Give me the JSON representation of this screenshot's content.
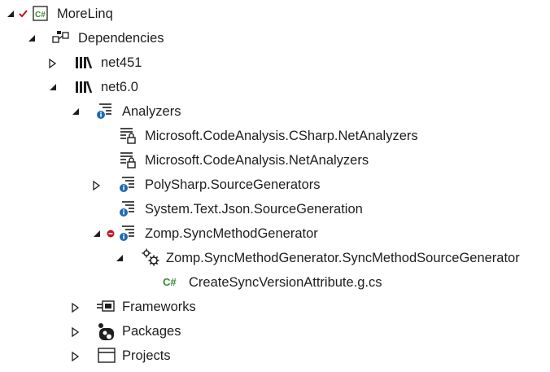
{
  "tree": {
    "root": {
      "label": "MoreLinq",
      "icon": "csharp-project-icon",
      "status": "checked"
    },
    "dependencies": {
      "label": "Dependencies",
      "icon": "dependencies-icon"
    },
    "net451": {
      "label": "net451",
      "icon": "framework-library-icon",
      "expanded": false
    },
    "net60": {
      "label": "net6.0",
      "icon": "framework-library-icon",
      "expanded": true
    },
    "analyzers": {
      "label": "Analyzers",
      "icon": "analyzer-info-icon",
      "expanded": true
    },
    "analyzer_items": [
      {
        "label": "Microsoft.CodeAnalysis.CSharp.NetAnalyzers",
        "icon": "analyzer-locked-icon"
      },
      {
        "label": "Microsoft.CodeAnalysis.NetAnalyzers",
        "icon": "analyzer-locked-icon"
      },
      {
        "label": "PolySharp.SourceGenerators",
        "icon": "analyzer-info-icon",
        "expanded": false
      },
      {
        "label": "System.Text.Json.SourceGeneration",
        "icon": "analyzer-info-icon"
      },
      {
        "label": "Zomp.SyncMethodGenerator",
        "icon": "analyzer-info-icon",
        "expanded": true,
        "status": "removed"
      }
    ],
    "generator": {
      "label": "Zomp.SyncMethodGenerator.SyncMethodSourceGenerator",
      "icon": "gears-icon",
      "expanded": true
    },
    "generated_file": {
      "label": "CreateSyncVersionAttribute.g.cs",
      "icon": "csharp-file-icon"
    },
    "frameworks": {
      "label": "Frameworks",
      "icon": "frameworks-icon",
      "expanded": false
    },
    "packages": {
      "label": "Packages",
      "icon": "nuget-package-icon",
      "expanded": false
    },
    "projects": {
      "label": "Projects",
      "icon": "project-window-icon",
      "expanded": false
    }
  },
  "colors": {
    "text": "#1e1e1e",
    "csharp_green": "#388a34",
    "info_blue": "#1e69b4",
    "check_red": "#c50f1f",
    "icon_dark": "#1e1e1e"
  }
}
